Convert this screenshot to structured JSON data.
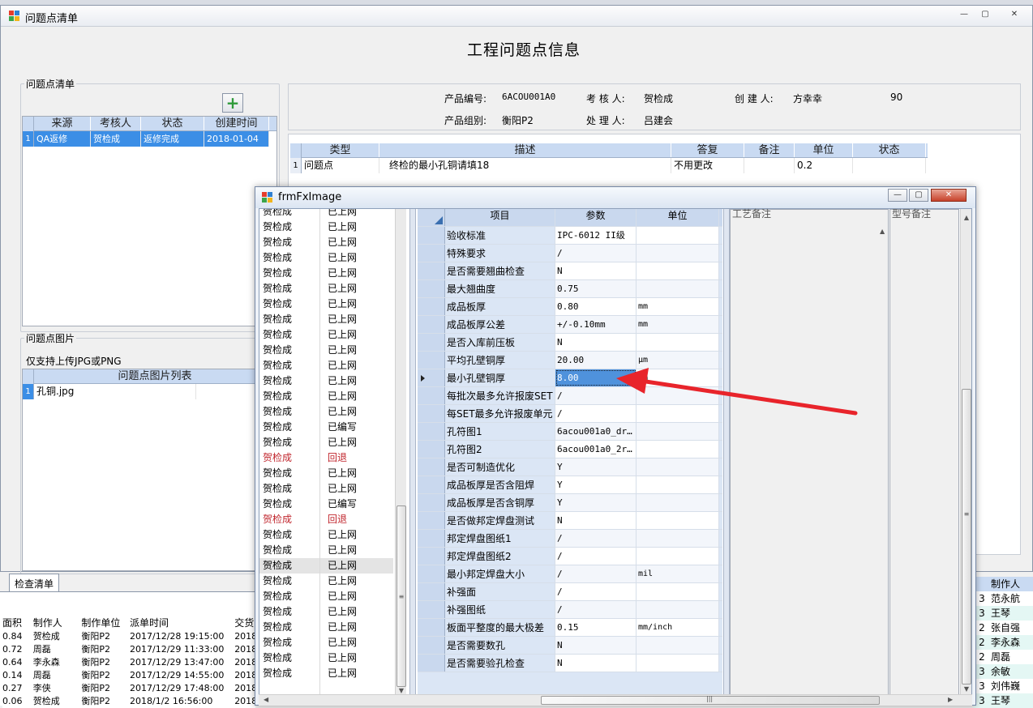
{
  "main_window": {
    "title": "问题点清单",
    "heading": "工程问题点信息",
    "controls": {
      "min": "—",
      "max": "▢",
      "close": "✕"
    }
  },
  "issue_list": {
    "legend": "问题点清单",
    "add_label": "+",
    "columns": [
      "来源",
      "考核人",
      "状态",
      "创建时间"
    ],
    "rows": [
      {
        "num": "1",
        "source": "QA返修",
        "assessor": "贺检成",
        "status": "返修完成",
        "created": "2018-01-04"
      }
    ]
  },
  "issue_images": {
    "legend": "问题点图片",
    "note": "仅支持上传JPG或PNG",
    "column": "问题点图片列表",
    "rows": [
      {
        "num": "1",
        "file": "孔铜.jpg"
      }
    ]
  },
  "info": {
    "product_code_label": "产品编号:",
    "product_code": "6ACOU001A0",
    "assessor_label": "考 核 人:",
    "assessor": "贺检成",
    "creator_label": "创 建 人:",
    "creator": "方幸幸",
    "number": "90",
    "product_group_label": "产品组别:",
    "product_group": "衡阳P2",
    "handler_label": "处 理 人:",
    "handler": "吕建会"
  },
  "detail_table": {
    "columns": [
      "类型",
      "描述",
      "答复",
      "备注",
      "单位",
      "状态"
    ],
    "rows": [
      {
        "num": "1",
        "type": "问题点",
        "desc": "终检的最小孔铜请填18",
        "reply": "不用更改",
        "note": "",
        "unit": "0.2",
        "status": ""
      }
    ]
  },
  "bottom": {
    "tab_label": "检查清单",
    "columns": [
      "面积",
      "制作人",
      "制作单位",
      "派单时间",
      "交货"
    ],
    "rows": [
      {
        "area": "0.84",
        "maker": "贺检成",
        "unit": "衡阳P2",
        "time": "2017/12/28 19:15:00",
        "ship": "2018"
      },
      {
        "area": "0.72",
        "maker": "周磊",
        "unit": "衡阳P2",
        "time": "2017/12/29 11:33:00",
        "ship": "2018"
      },
      {
        "area": "0.64",
        "maker": "李永森",
        "unit": "衡阳P2",
        "time": "2017/12/29 13:47:00",
        "ship": "2018"
      },
      {
        "area": "0.14",
        "maker": "周磊",
        "unit": "衡阳P2",
        "time": "2017/12/29 14:55:00",
        "ship": "2018"
      },
      {
        "area": "0.27",
        "maker": "李侠",
        "unit": "衡阳P2",
        "time": "2017/12/29 17:48:00",
        "ship": "2018"
      },
      {
        "area": "0.06",
        "maker": "贺检成",
        "unit": "衡阳P2",
        "time": "2018/1/2 16:56:00",
        "ship": "2018"
      }
    ],
    "right_header": "制作人",
    "right_rows": [
      {
        "n": "3",
        "name": "范永航"
      },
      {
        "n": "3",
        "name": "王琴"
      },
      {
        "n": "2",
        "name": "张自强"
      },
      {
        "n": "2",
        "name": "李永森"
      },
      {
        "n": "2",
        "name": "周磊"
      },
      {
        "n": "3",
        "name": "余敏"
      },
      {
        "n": "3",
        "name": "刘伟巍"
      },
      {
        "n": "3",
        "name": "王琴"
      }
    ]
  },
  "popup": {
    "title": "frmFxImage",
    "controls": {
      "min": "—",
      "max": "▢",
      "close": "✕"
    },
    "list": [
      {
        "name": "贺检成",
        "status": "已上网"
      },
      {
        "name": "贺检成",
        "status": "已上网"
      },
      {
        "name": "贺检成",
        "status": "已上网"
      },
      {
        "name": "贺检成",
        "status": "已上网"
      },
      {
        "name": "贺检成",
        "status": "已上网"
      },
      {
        "name": "贺检成",
        "status": "已上网"
      },
      {
        "name": "贺检成",
        "status": "已上网"
      },
      {
        "name": "贺检成",
        "status": "已上网"
      },
      {
        "name": "贺检成",
        "status": "已上网"
      },
      {
        "name": "贺检成",
        "status": "已上网"
      },
      {
        "name": "贺检成",
        "status": "已上网"
      },
      {
        "name": "贺检成",
        "status": "已上网"
      },
      {
        "name": "贺检成",
        "status": "已上网"
      },
      {
        "name": "贺检成",
        "status": "已上网"
      },
      {
        "name": "贺检成",
        "status": "已编写"
      },
      {
        "name": "贺检成",
        "status": "已上网"
      },
      {
        "name": "贺检成",
        "status": "回退",
        "red": true
      },
      {
        "name": "贺检成",
        "status": "已上网"
      },
      {
        "name": "贺检成",
        "status": "已上网"
      },
      {
        "name": "贺检成",
        "status": "已编写"
      },
      {
        "name": "贺检成",
        "status": "回退",
        "red": true
      },
      {
        "name": "贺检成",
        "status": "已上网"
      },
      {
        "name": "贺检成",
        "status": "已上网"
      },
      {
        "name": "贺检成",
        "status": "已上网",
        "highlight": true
      },
      {
        "name": "贺检成",
        "status": "已上网"
      },
      {
        "name": "贺检成",
        "status": "已上网"
      },
      {
        "name": "贺检成",
        "status": "已上网"
      },
      {
        "name": "贺检成",
        "status": "已上网"
      },
      {
        "name": "贺检成",
        "status": "已上网"
      },
      {
        "name": "贺检成",
        "status": "已上网"
      },
      {
        "name": "贺检成",
        "status": "已上网"
      }
    ],
    "param_columns": [
      "项目",
      "参数",
      "单位"
    ],
    "params": [
      {
        "item": "验收标准",
        "value": "IPC-6012 II级",
        "unit": ""
      },
      {
        "item": "特殊要求",
        "value": "/",
        "unit": ""
      },
      {
        "item": "是否需要翘曲检查",
        "value": "N",
        "unit": ""
      },
      {
        "item": "最大翘曲度",
        "value": "0.75",
        "unit": ""
      },
      {
        "item": "成品板厚",
        "value": "0.80",
        "unit": "mm"
      },
      {
        "item": "成品板厚公差",
        "value": "+/-0.10mm",
        "unit": "mm"
      },
      {
        "item": "是否入库前压板",
        "value": "N",
        "unit": ""
      },
      {
        "item": "平均孔壁铜厚",
        "value": "20.00",
        "unit": "μm"
      },
      {
        "item": "最小孔壁铜厚",
        "value": "8.00",
        "unit": "μm",
        "current": true
      },
      {
        "item": "每批次最多允许报废SET",
        "value": "/",
        "unit": ""
      },
      {
        "item": "每SET最多允许报废单元",
        "value": "/",
        "unit": ""
      },
      {
        "item": "孔符图1",
        "value": "6acou001a0_dr…",
        "unit": ""
      },
      {
        "item": "孔符图2",
        "value": "6acou001a0_2r…",
        "unit": ""
      },
      {
        "item": "是否可制造优化",
        "value": "Y",
        "unit": ""
      },
      {
        "item": "成品板厚是否含阻焊",
        "value": "Y",
        "unit": ""
      },
      {
        "item": "成品板厚是否含铜厚",
        "value": "Y",
        "unit": ""
      },
      {
        "item": "是否做邦定焊盘测试",
        "value": "N",
        "unit": ""
      },
      {
        "item": "邦定焊盘图纸1",
        "value": "/",
        "unit": ""
      },
      {
        "item": "邦定焊盘图纸2",
        "value": "/",
        "unit": ""
      },
      {
        "item": "最小邦定焊盘大小",
        "value": "/",
        "unit": "mil"
      },
      {
        "item": "补强面",
        "value": "/",
        "unit": ""
      },
      {
        "item": "补强图纸",
        "value": "/",
        "unit": ""
      },
      {
        "item": "板面平整度的最大极差",
        "value": "0.15",
        "unit": "mm/inch"
      },
      {
        "item": "是否需要数孔",
        "value": "N",
        "unit": ""
      },
      {
        "item": "是否需要验孔检查",
        "value": "N",
        "unit": ""
      }
    ],
    "right_headers": [
      "工艺备注",
      "型号备注"
    ]
  },
  "annotation": {
    "arrow_color": "#e8242b"
  },
  "colors": {
    "grid_header": "#c9daf2",
    "selection": "#3b8ee6",
    "reject": "#c0262d"
  }
}
